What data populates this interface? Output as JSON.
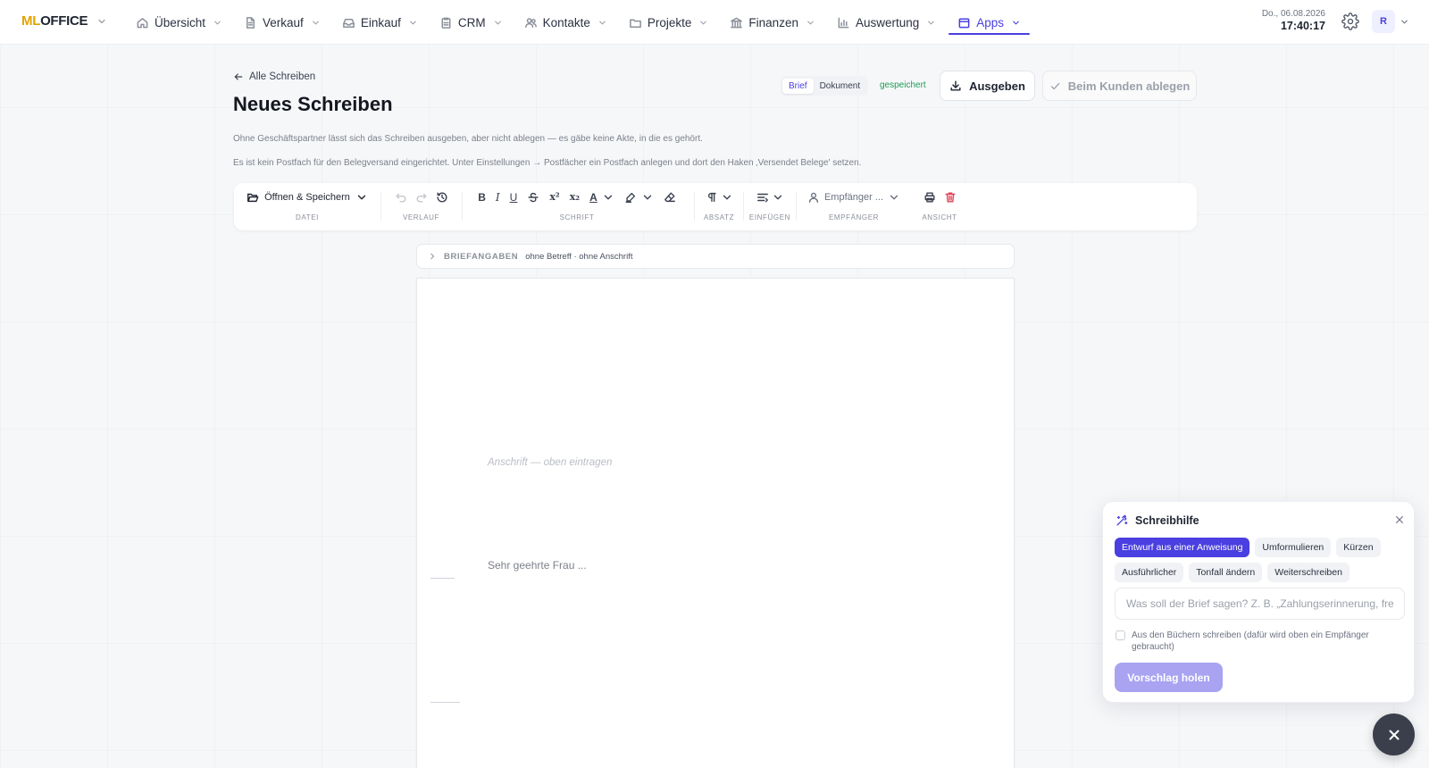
{
  "app": {
    "logo_ml": "ML",
    "logo_office": "OFFICE"
  },
  "nav": [
    {
      "label": "Übersicht",
      "icon": "home-icon"
    },
    {
      "label": "Verkauf",
      "icon": "document-icon"
    },
    {
      "label": "Einkauf",
      "icon": "inbox-icon"
    },
    {
      "label": "CRM",
      "icon": "clipboard-icon"
    },
    {
      "label": "Kontakte",
      "icon": "users-icon"
    },
    {
      "label": "Projekte",
      "icon": "folder-icon"
    },
    {
      "label": "Finanzen",
      "icon": "bank-icon"
    },
    {
      "label": "Auswertung",
      "icon": "bar-chart-icon"
    },
    {
      "label": "Apps",
      "icon": "calendar-icon",
      "active": true
    }
  ],
  "clock": {
    "date": "Do., 06.08.2026",
    "time": "17:40:17"
  },
  "user": {
    "initial": "R"
  },
  "header": {
    "back_label": "Alle Schreiben",
    "title": "Neues Schreiben",
    "hint_partner": "Ohne Geschäftspartner lässt sich das Schreiben ausgeben, aber nicht ablegen — es gäbe keine Akte, in die es gehört.",
    "hint_postbox": "Es ist kein Postfach für den Belegversand eingerichtet. Unter Einstellungen → Postfächer ein Postfach anlegen und dort den Haken ‚Versendet Belege' setzen.",
    "mode_brief": "Brief",
    "mode_dokument": "Dokument",
    "status": "gespeichert",
    "output_label": "Ausgeben",
    "file_label": "Beim Kunden ablegen"
  },
  "toolbar": {
    "open_save": "Öffnen & Speichern",
    "cap_datei": "DATEI",
    "cap_verlauf": "VERLAUF",
    "cap_schrift": "SCHRIFT",
    "cap_absatz": "ABSATZ",
    "cap_einfuegen": "EINFÜGEN",
    "cap_empfaenger": "EMPFÄNGER",
    "cap_ansicht": "ANSICHT",
    "recipient": "Empfänger ...",
    "bold": "B",
    "italic": "I",
    "underline": "U",
    "superscript": "x²",
    "subscript": "x₂",
    "font_color": "A"
  },
  "brief": {
    "label": "BRIEFANGABEN",
    "summary": "ohne Betreff · ohne Anschrift"
  },
  "page": {
    "address_placeholder": "Anschrift — oben eintragen",
    "salutation": "Sehr geehrte Frau ..."
  },
  "assistant": {
    "title": "Schreibhilfe",
    "chips": [
      "Entwurf aus einer Anweisung",
      "Umformulieren",
      "Kürzen",
      "Ausführlicher",
      "Tonfall ändern",
      "Weiterschreiben"
    ],
    "prompt_placeholder": "Was soll der Brief sagen? Z. B. „Zahlungserinnerung, freundlich\"",
    "checkbox_label": "Aus den Büchern schreiben (dafür wird oben ein Empfänger gebraucht)",
    "suggest_label": "Vorschlag holen"
  }
}
